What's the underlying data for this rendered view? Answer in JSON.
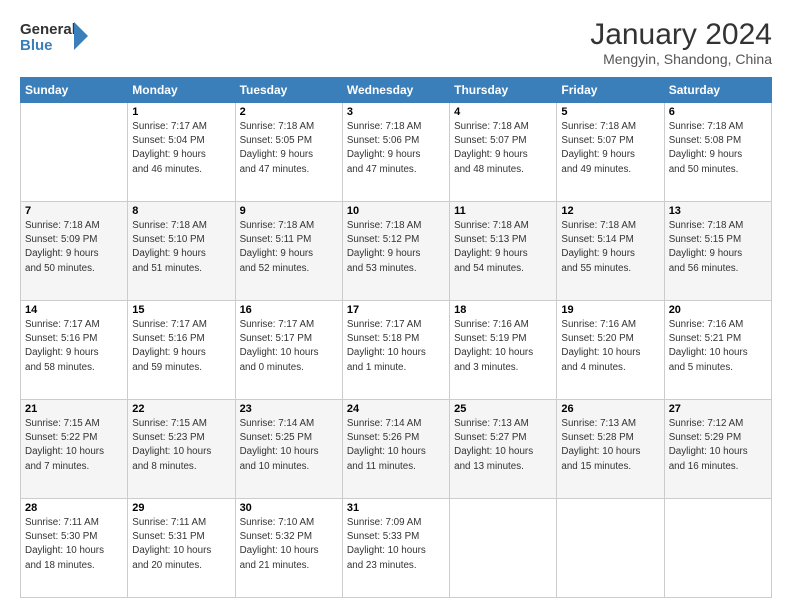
{
  "header": {
    "logo_line1": "General",
    "logo_line2": "Blue",
    "main_title": "January 2024",
    "subtitle": "Mengyin, Shandong, China"
  },
  "days_of_week": [
    "Sunday",
    "Monday",
    "Tuesday",
    "Wednesday",
    "Thursday",
    "Friday",
    "Saturday"
  ],
  "weeks": [
    [
      {
        "day": "",
        "info": ""
      },
      {
        "day": "1",
        "info": "Sunrise: 7:17 AM\nSunset: 5:04 PM\nDaylight: 9 hours\nand 46 minutes."
      },
      {
        "day": "2",
        "info": "Sunrise: 7:18 AM\nSunset: 5:05 PM\nDaylight: 9 hours\nand 47 minutes."
      },
      {
        "day": "3",
        "info": "Sunrise: 7:18 AM\nSunset: 5:06 PM\nDaylight: 9 hours\nand 47 minutes."
      },
      {
        "day": "4",
        "info": "Sunrise: 7:18 AM\nSunset: 5:07 PM\nDaylight: 9 hours\nand 48 minutes."
      },
      {
        "day": "5",
        "info": "Sunrise: 7:18 AM\nSunset: 5:07 PM\nDaylight: 9 hours\nand 49 minutes."
      },
      {
        "day": "6",
        "info": "Sunrise: 7:18 AM\nSunset: 5:08 PM\nDaylight: 9 hours\nand 50 minutes."
      }
    ],
    [
      {
        "day": "7",
        "info": "Sunrise: 7:18 AM\nSunset: 5:09 PM\nDaylight: 9 hours\nand 50 minutes."
      },
      {
        "day": "8",
        "info": "Sunrise: 7:18 AM\nSunset: 5:10 PM\nDaylight: 9 hours\nand 51 minutes."
      },
      {
        "day": "9",
        "info": "Sunrise: 7:18 AM\nSunset: 5:11 PM\nDaylight: 9 hours\nand 52 minutes."
      },
      {
        "day": "10",
        "info": "Sunrise: 7:18 AM\nSunset: 5:12 PM\nDaylight: 9 hours\nand 53 minutes."
      },
      {
        "day": "11",
        "info": "Sunrise: 7:18 AM\nSunset: 5:13 PM\nDaylight: 9 hours\nand 54 minutes."
      },
      {
        "day": "12",
        "info": "Sunrise: 7:18 AM\nSunset: 5:14 PM\nDaylight: 9 hours\nand 55 minutes."
      },
      {
        "day": "13",
        "info": "Sunrise: 7:18 AM\nSunset: 5:15 PM\nDaylight: 9 hours\nand 56 minutes."
      }
    ],
    [
      {
        "day": "14",
        "info": "Sunrise: 7:17 AM\nSunset: 5:16 PM\nDaylight: 9 hours\nand 58 minutes."
      },
      {
        "day": "15",
        "info": "Sunrise: 7:17 AM\nSunset: 5:16 PM\nDaylight: 9 hours\nand 59 minutes."
      },
      {
        "day": "16",
        "info": "Sunrise: 7:17 AM\nSunset: 5:17 PM\nDaylight: 10 hours\nand 0 minutes."
      },
      {
        "day": "17",
        "info": "Sunrise: 7:17 AM\nSunset: 5:18 PM\nDaylight: 10 hours\nand 1 minute."
      },
      {
        "day": "18",
        "info": "Sunrise: 7:16 AM\nSunset: 5:19 PM\nDaylight: 10 hours\nand 3 minutes."
      },
      {
        "day": "19",
        "info": "Sunrise: 7:16 AM\nSunset: 5:20 PM\nDaylight: 10 hours\nand 4 minutes."
      },
      {
        "day": "20",
        "info": "Sunrise: 7:16 AM\nSunset: 5:21 PM\nDaylight: 10 hours\nand 5 minutes."
      }
    ],
    [
      {
        "day": "21",
        "info": "Sunrise: 7:15 AM\nSunset: 5:22 PM\nDaylight: 10 hours\nand 7 minutes."
      },
      {
        "day": "22",
        "info": "Sunrise: 7:15 AM\nSunset: 5:23 PM\nDaylight: 10 hours\nand 8 minutes."
      },
      {
        "day": "23",
        "info": "Sunrise: 7:14 AM\nSunset: 5:25 PM\nDaylight: 10 hours\nand 10 minutes."
      },
      {
        "day": "24",
        "info": "Sunrise: 7:14 AM\nSunset: 5:26 PM\nDaylight: 10 hours\nand 11 minutes."
      },
      {
        "day": "25",
        "info": "Sunrise: 7:13 AM\nSunset: 5:27 PM\nDaylight: 10 hours\nand 13 minutes."
      },
      {
        "day": "26",
        "info": "Sunrise: 7:13 AM\nSunset: 5:28 PM\nDaylight: 10 hours\nand 15 minutes."
      },
      {
        "day": "27",
        "info": "Sunrise: 7:12 AM\nSunset: 5:29 PM\nDaylight: 10 hours\nand 16 minutes."
      }
    ],
    [
      {
        "day": "28",
        "info": "Sunrise: 7:11 AM\nSunset: 5:30 PM\nDaylight: 10 hours\nand 18 minutes."
      },
      {
        "day": "29",
        "info": "Sunrise: 7:11 AM\nSunset: 5:31 PM\nDaylight: 10 hours\nand 20 minutes."
      },
      {
        "day": "30",
        "info": "Sunrise: 7:10 AM\nSunset: 5:32 PM\nDaylight: 10 hours\nand 21 minutes."
      },
      {
        "day": "31",
        "info": "Sunrise: 7:09 AM\nSunset: 5:33 PM\nDaylight: 10 hours\nand 23 minutes."
      },
      {
        "day": "",
        "info": ""
      },
      {
        "day": "",
        "info": ""
      },
      {
        "day": "",
        "info": ""
      }
    ]
  ]
}
